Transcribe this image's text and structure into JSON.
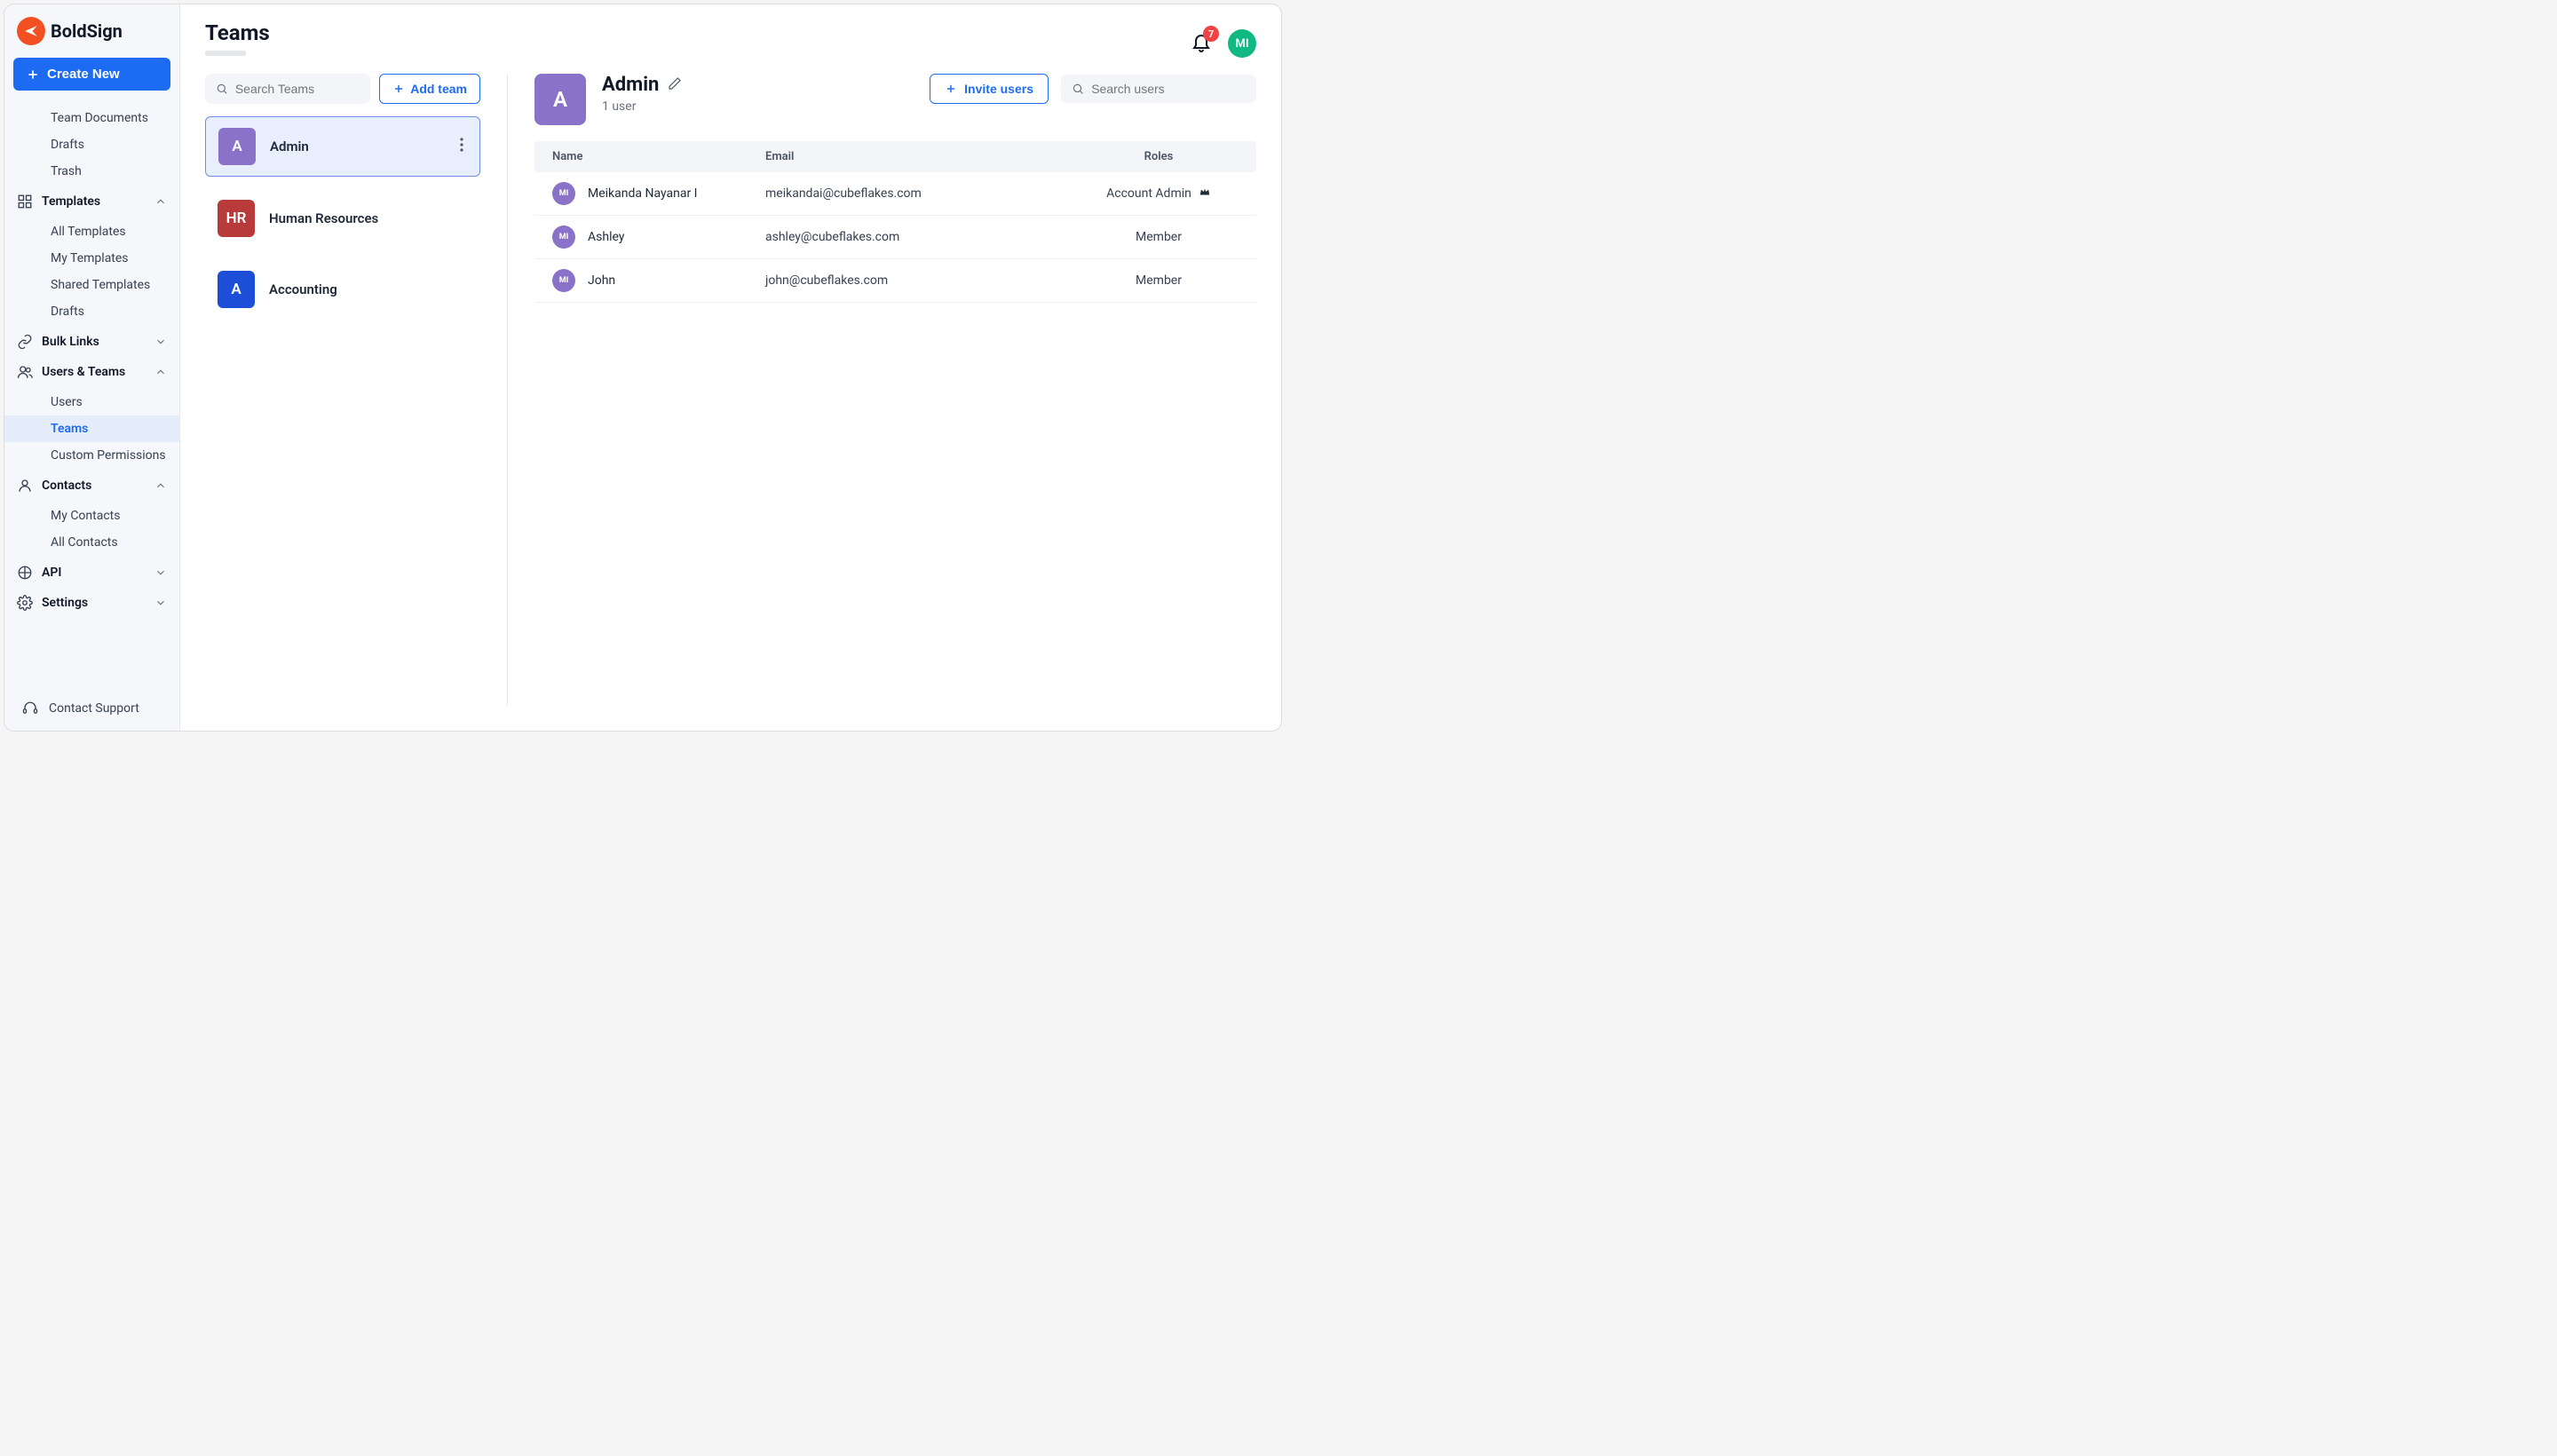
{
  "brand": {
    "name": "BoldSign"
  },
  "sidebar": {
    "create_label": "Create New",
    "doc_items": [
      "Team Documents",
      "Drafts",
      "Trash"
    ],
    "templates": {
      "label": "Templates",
      "items": [
        "All Templates",
        "My Templates",
        "Shared Templates",
        "Drafts"
      ]
    },
    "bulk_links": {
      "label": "Bulk Links"
    },
    "users_teams": {
      "label": "Users & Teams",
      "items": [
        "Users",
        "Teams",
        "Custom Permissions"
      ],
      "active_index": 1
    },
    "contacts": {
      "label": "Contacts",
      "items": [
        "My Contacts",
        "All Contacts"
      ]
    },
    "api": {
      "label": "API"
    },
    "settings": {
      "label": "Settings"
    },
    "support": {
      "label": "Contact Support"
    }
  },
  "header": {
    "title": "Teams",
    "notifications": "7",
    "avatar": "MI"
  },
  "teams_panel": {
    "search_placeholder": "Search Teams",
    "add_label": "Add team",
    "teams": [
      {
        "initials": "A",
        "name": "Admin",
        "color": "#8b72c9",
        "selected": true
      },
      {
        "initials": "HR",
        "name": "Human Resources",
        "color": "#b93a3a",
        "selected": false
      },
      {
        "initials": "A",
        "name": "Accounting",
        "color": "#1d4ed8",
        "selected": false
      }
    ]
  },
  "detail": {
    "chip_initial": "A",
    "chip_color": "#8b72c9",
    "title": "Admin",
    "subtitle": "1 user",
    "invite_label": "Invite users",
    "user_search_placeholder": "Search users",
    "columns": {
      "name": "Name",
      "email": "Email",
      "role": "Roles"
    },
    "users": [
      {
        "avatar": "MI",
        "name": "Meikanda Nayanar I",
        "email": "meikandai@cubeflakes.com",
        "role": "Account Admin",
        "is_admin": true
      },
      {
        "avatar": "MI",
        "name": "Ashley",
        "email": "ashley@cubeflakes.com",
        "role": "Member",
        "is_admin": false
      },
      {
        "avatar": "MI",
        "name": "John",
        "email": "john@cubeflakes.com",
        "role": "Member",
        "is_admin": false
      }
    ]
  }
}
